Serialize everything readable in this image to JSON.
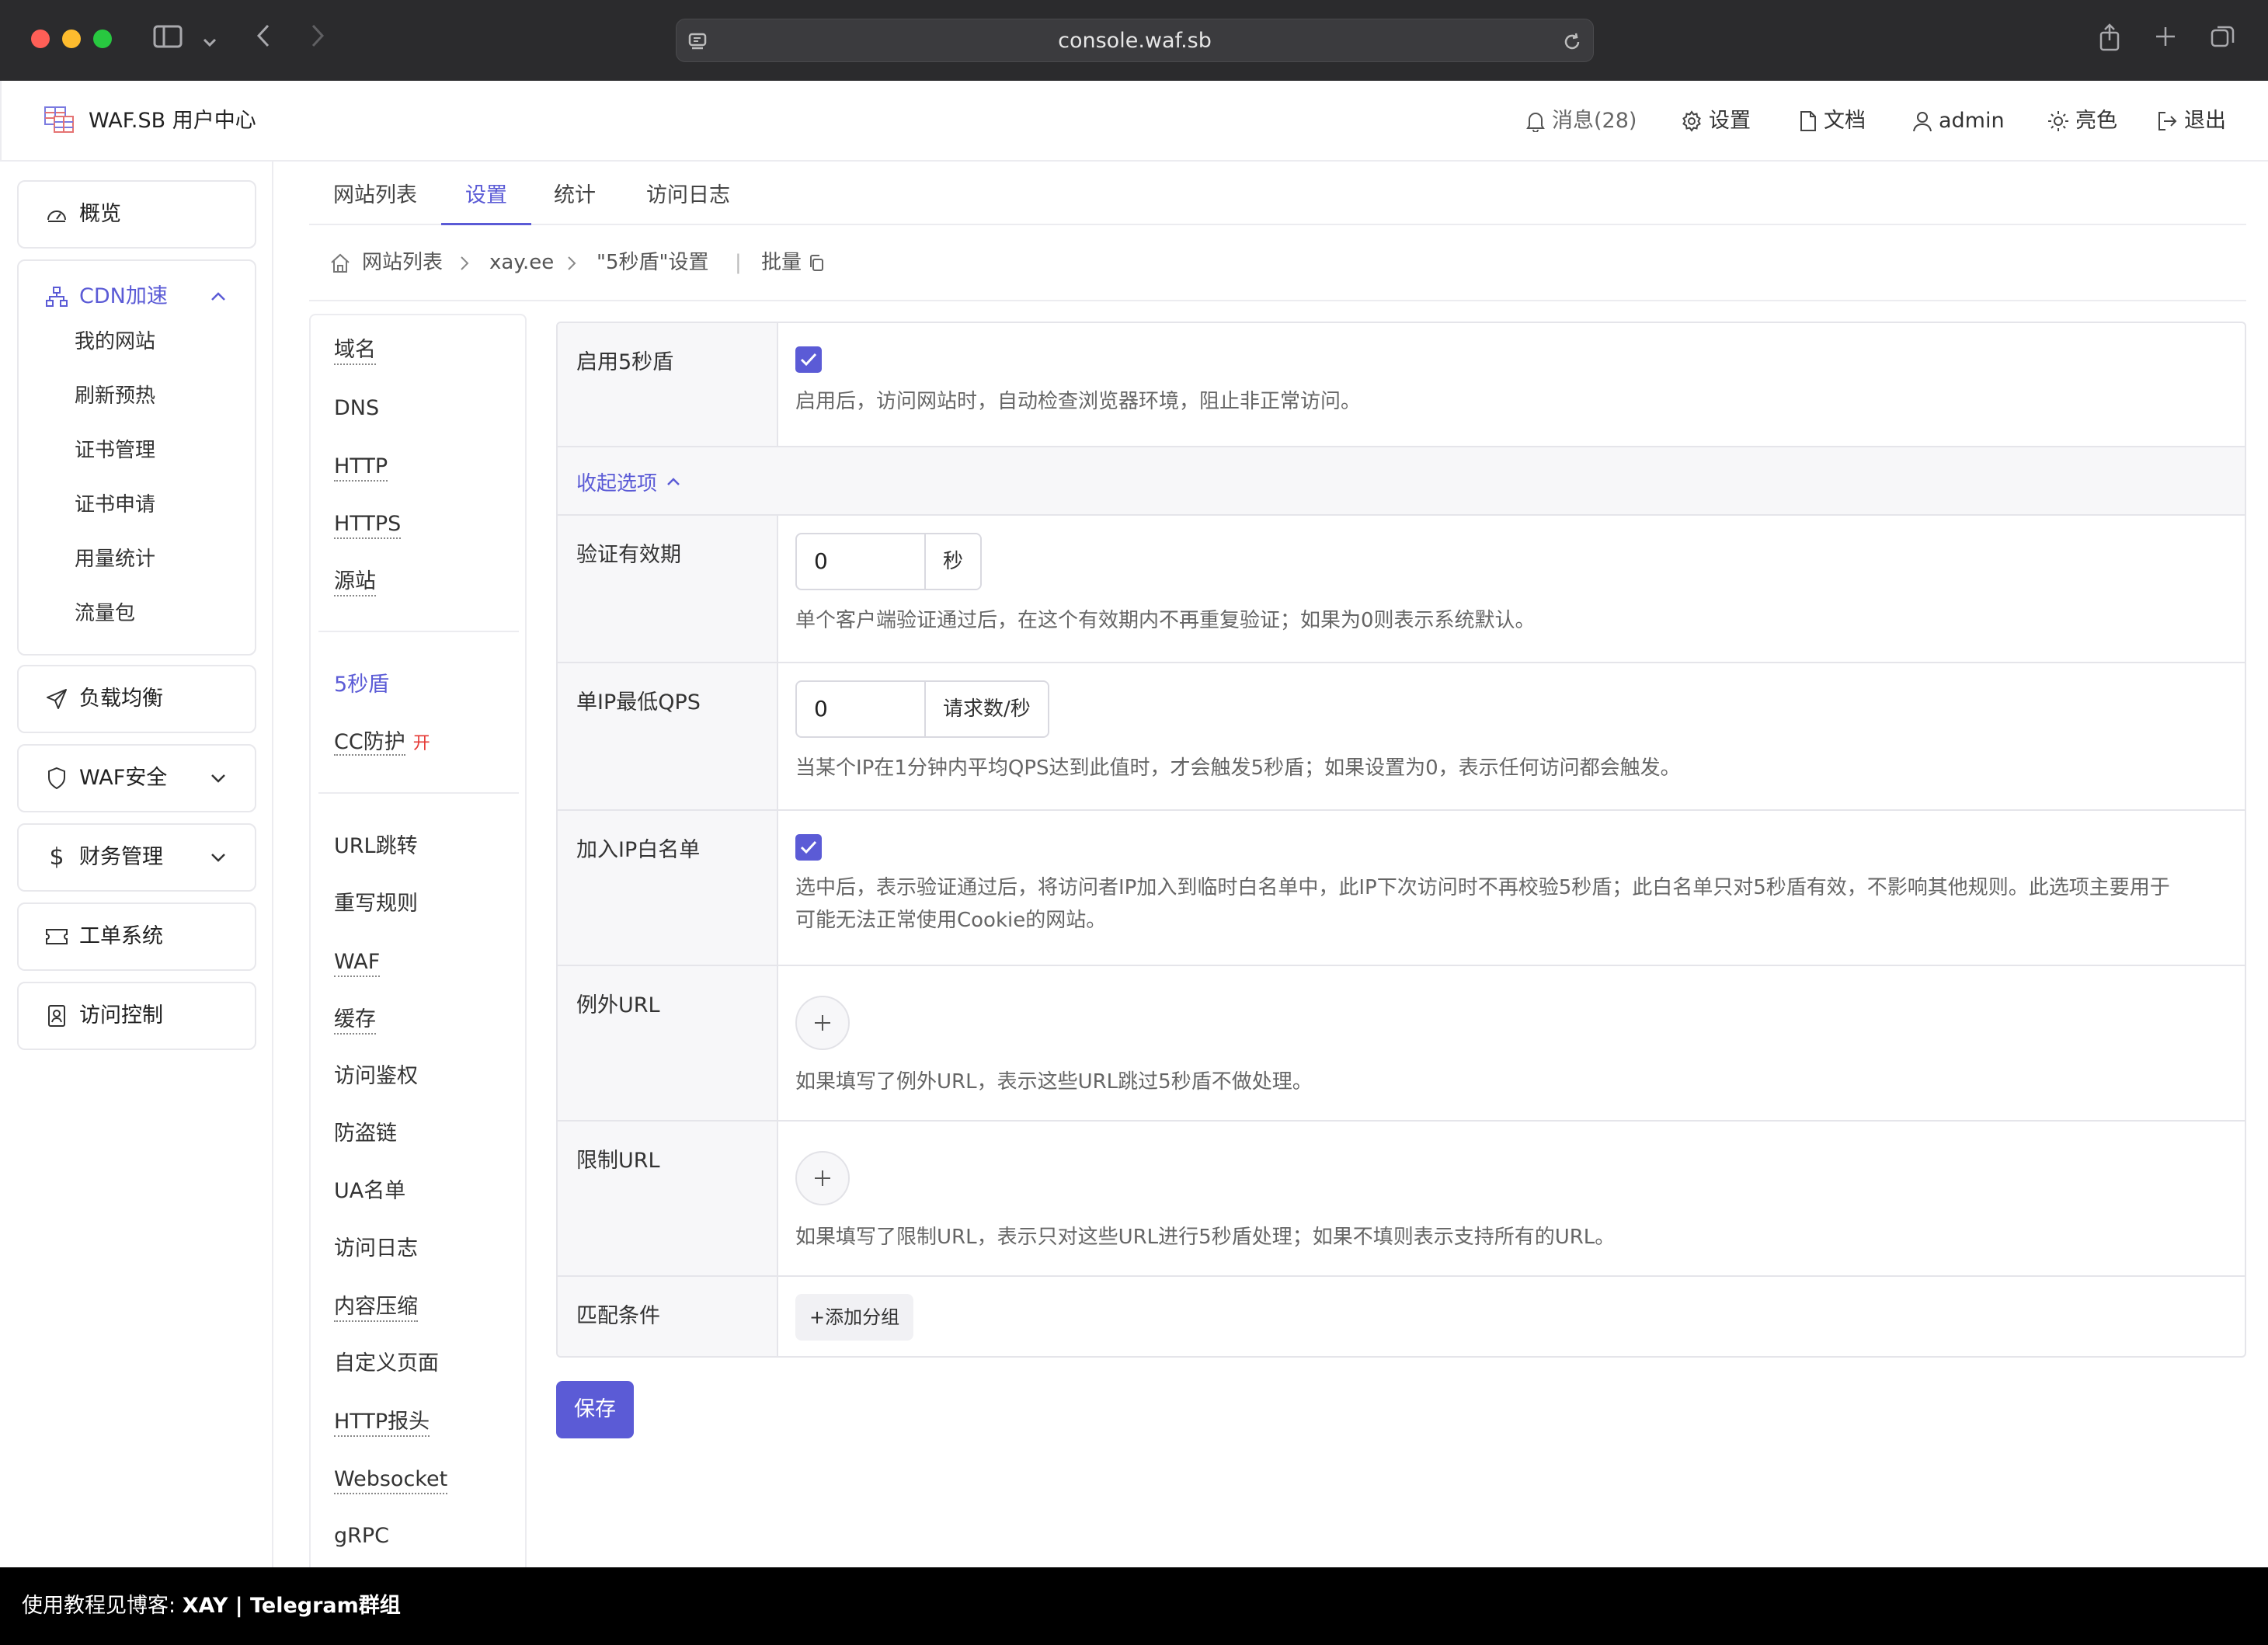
{
  "browser": {
    "url": "console.waf.sb"
  },
  "header": {
    "brand": "WAF.SB 用户中心",
    "messages": "消息(28)",
    "settings": "设置",
    "docs": "文档",
    "user": "admin",
    "theme": "亮色",
    "logout": "退出"
  },
  "sidebar": {
    "overview": "概览",
    "cdn": "CDN加速",
    "cdn_items": [
      "我的网站",
      "刷新预热",
      "证书管理",
      "证书申请",
      "用量统计",
      "流量包"
    ],
    "load_balance": "负载均衡",
    "waf": "WAF安全",
    "finance": "财务管理",
    "ticket": "工单系统",
    "access": "访问控制"
  },
  "tabs": [
    "网站列表",
    "设置",
    "统计",
    "访问日志"
  ],
  "breadcrumb": {
    "home": "网站列表",
    "site": "xay.ee",
    "page": "\"5秒盾\"设置",
    "batch": "批量"
  },
  "subnav": {
    "group1": [
      "域名",
      "DNS",
      "HTTP",
      "HTTPS",
      "源站"
    ],
    "group2": [
      "5秒盾",
      "CC防护"
    ],
    "cc_badge": "开",
    "group3": [
      "URL跳转",
      "重写规则",
      "WAF",
      "缓存",
      "访问鉴权",
      "防盗链",
      "UA名单",
      "访问日志",
      "内容压缩",
      "自定义页面",
      "HTTP报头",
      "Websocket",
      "gRPC"
    ]
  },
  "settings": {
    "enable": {
      "label": "启用5秒盾",
      "checked": true,
      "desc": "启用后，访问网站时，自动检查浏览器环境，阻止非正常访问。"
    },
    "collapse": "收起选项",
    "validity": {
      "label": "验证有效期",
      "value": "0",
      "unit": "秒",
      "desc": "单个客户端验证通过后，在这个有效期内不再重复验证；如果为0则表示系统默认。"
    },
    "qps": {
      "label": "单IP最低QPS",
      "value": "0",
      "unit": "请求数/秒",
      "desc": "当某个IP在1分钟内平均QPS达到此值时，才会触发5秒盾；如果设置为0，表示任何访问都会触发。"
    },
    "whitelist": {
      "label": "加入IP白名单",
      "checked": true,
      "desc1": "选中后，表示验证通过后，将访问者IP加入到临时白名单中，此IP下次访问时不再校验5秒盾；此白名单只对5秒盾有效，不影响其他规则。此选项主要用于",
      "desc2": "可能无法正常使用Cookie的网站。"
    },
    "except_url": {
      "label": "例外URL",
      "desc": "如果填写了例外URL，表示这些URL跳过5秒盾不做处理。"
    },
    "limit_url": {
      "label": "限制URL",
      "desc": "如果填写了限制URL，表示只对这些URL进行5秒盾处理；如果不填则表示支持所有的URL。"
    },
    "match": {
      "label": "匹配条件",
      "button": "+添加分组"
    }
  },
  "save": "保存",
  "banner": {
    "prefix": "使用教程见博客: ",
    "blog": "XAY",
    "sep": " | ",
    "group": "Telegram群组"
  }
}
